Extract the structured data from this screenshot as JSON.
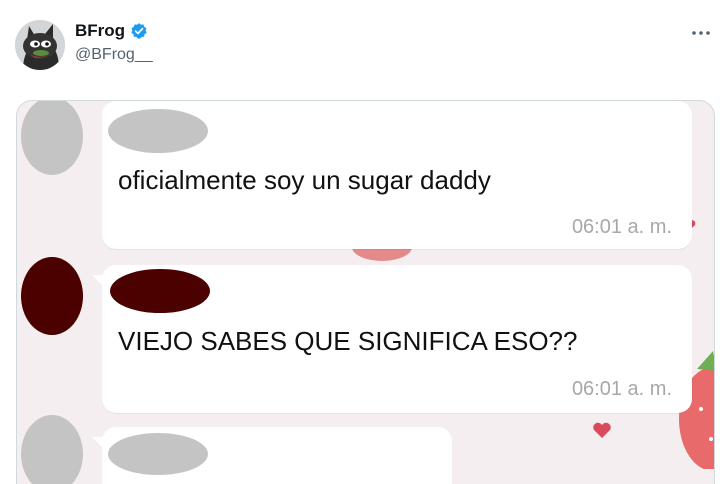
{
  "header": {
    "display_name": "BFrog",
    "handle": "@BFrog__",
    "verified": true,
    "more_icon": "more-horizontal-icon",
    "verified_color": "#1d9bf0"
  },
  "screenshot": {
    "background_color": "#f5eef0",
    "messages": [
      {
        "text": "oficialmente soy un sugar daddy",
        "time": "06:01 a. m.",
        "avatar_color": "#c4c4c4"
      },
      {
        "text": "VIEJO SABES QUE SIGNIFICA ESO??",
        "time": "06:01 a. m.",
        "avatar_color": "#4a0100"
      },
      {
        "text": "",
        "time": "",
        "avatar_color": "#c4c4c4"
      }
    ]
  }
}
